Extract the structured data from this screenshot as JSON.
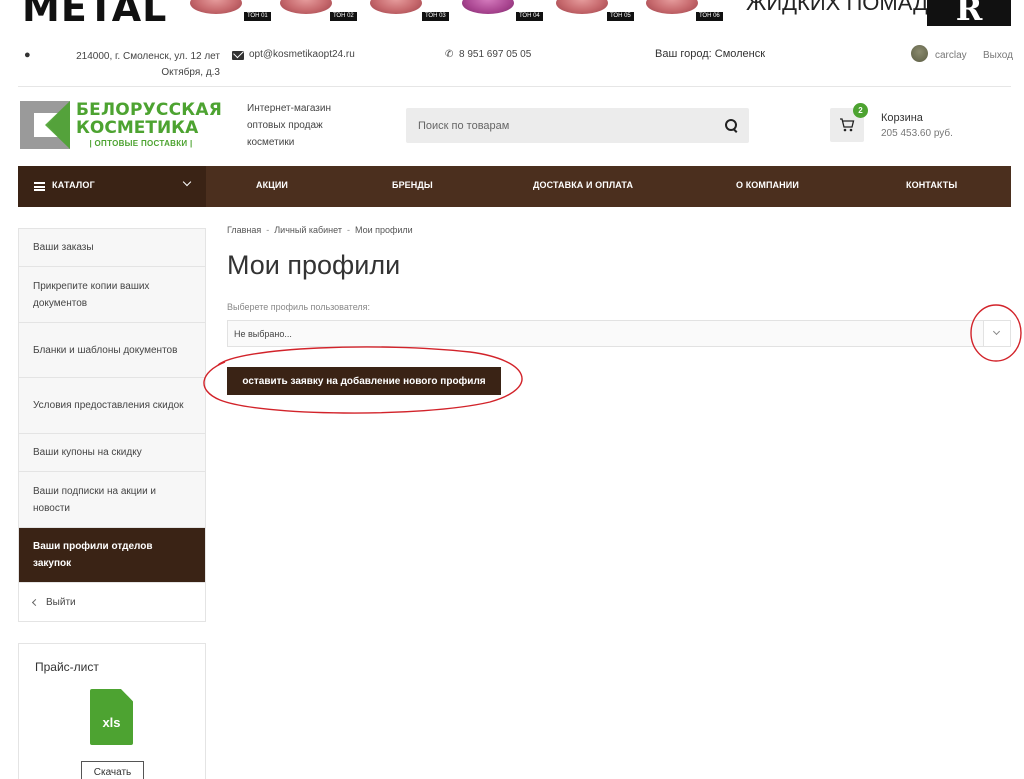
{
  "banner": {
    "brand_word": "METAL",
    "tones": [
      "ТОН 01",
      "ТОН 02",
      "ТОН 03",
      "ТОН 04",
      "ТОН 05",
      "ТОН 06"
    ],
    "right_text": "ЖИДКИХ ПОМАД",
    "right_logo": "R"
  },
  "topbar": {
    "address_line1": "214000, г. Смоленск, ул. 12 лет",
    "address_line2": "Октября, д.3",
    "email": "opt@kosmetikaopt24.ru",
    "phone": "8 951 697 05 05",
    "city": "Ваш город: Смоленск",
    "username": "carclay",
    "logout": "Выход"
  },
  "header": {
    "logo_line1": "БЕЛОРУССКАЯ",
    "logo_line2": "КОСМЕТИКА",
    "logo_line3": "| ОПТОВЫЕ ПОСТАВКИ |",
    "slogan": "Интернет-магазин оптовых продаж косметики",
    "search_placeholder": "Поиск по товарам",
    "cart_count": "2",
    "cart_title": "Корзина",
    "cart_sum": "205 453.60 руб."
  },
  "nav": {
    "catalog": "КАТАЛОГ",
    "items": [
      "АКЦИИ",
      "БРЕНДЫ",
      "ДОСТАВКА И ОПЛАТА",
      "О КОМПАНИИ",
      "КОНТАКТЫ"
    ]
  },
  "sidebar": {
    "items": [
      "Ваши заказы",
      "Прикрепите копии ваших документов",
      "Бланки и шаблоны документов",
      "Условия предоставления скидок",
      "Ваши купоны на скидку",
      "Ваши подписки на акции и новости",
      "Ваши профили отделов закупок"
    ],
    "logout": "Выйти",
    "price_title": "Прайс-лист",
    "xls_label": "xls",
    "download": "Скачать"
  },
  "main": {
    "breadcrumbs": [
      "Главная",
      "Личный кабинет",
      "Мои профили"
    ],
    "title": "Мои профили",
    "select_label": "Выберете профиль пользователя:",
    "select_value": "Не выбрано...",
    "request_button": "оставить заявку на добавление нового профиля"
  },
  "colors": {
    "brand_green": "#4da331",
    "nav_brown": "#4b2f1e",
    "dark_brown": "#3a2315",
    "annotation_red": "#d2232a"
  }
}
